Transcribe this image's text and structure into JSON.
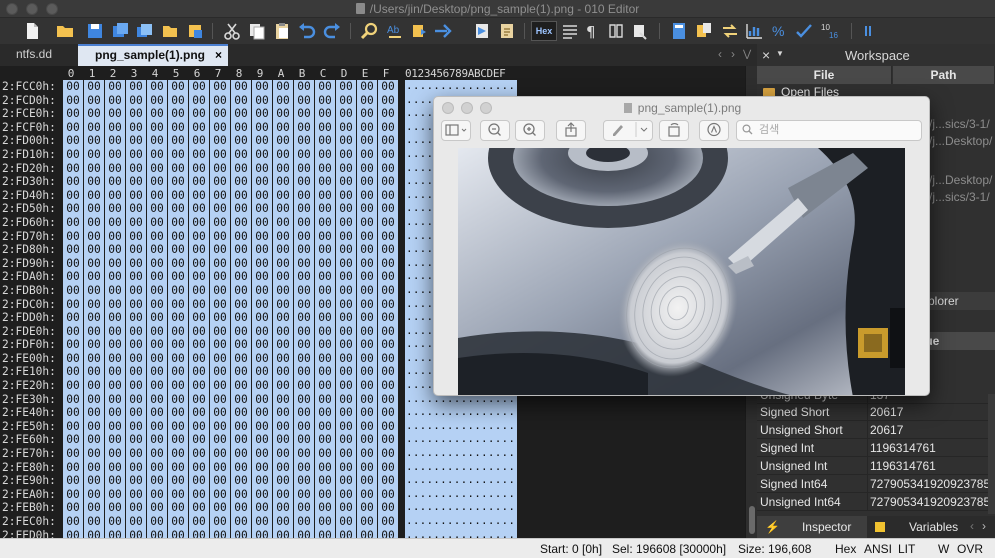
{
  "window": {
    "title": "/Users/jin/Desktop/png_sample(1).png - 010 Editor"
  },
  "toolbar": {
    "hex_label": "Hex"
  },
  "tabs": [
    {
      "label": "ntfs.dd"
    },
    {
      "label": "png_sample(1).png"
    }
  ],
  "tab_nav": {
    "left": "‹",
    "right": "›",
    "menu": "⋁",
    "close": "×"
  },
  "hex": {
    "column_headers": [
      "0",
      "1",
      "2",
      "3",
      "4",
      "5",
      "6",
      "7",
      "8",
      "9",
      "A",
      "B",
      "C",
      "D",
      "E",
      "F"
    ],
    "ascii_header": "0123456789ABCDEF",
    "byte_value": "00",
    "ascii_row": "................",
    "rows": [
      "2:FCC0h:",
      "2:FCD0h:",
      "2:FCE0h:",
      "2:FCF0h:",
      "2:FD00h:",
      "2:FD10h:",
      "2:FD20h:",
      "2:FD30h:",
      "2:FD40h:",
      "2:FD50h:",
      "2:FD60h:",
      "2:FD70h:",
      "2:FD80h:",
      "2:FD90h:",
      "2:FDA0h:",
      "2:FDB0h:",
      "2:FDC0h:",
      "2:FDD0h:",
      "2:FDE0h:",
      "2:FDF0h:",
      "2:FE00h:",
      "2:FE10h:",
      "2:FE20h:",
      "2:FE30h:",
      "2:FE40h:",
      "2:FE50h:",
      "2:FE60h:",
      "2:FE70h:",
      "2:FE80h:",
      "2:FE90h:",
      "2:FEA0h:",
      "2:FEB0h:",
      "2:FEC0h:",
      "2:FED0h:"
    ]
  },
  "workspace": {
    "title": "Workspace",
    "close": "×",
    "col_file": "File",
    "col_path": "Path",
    "open_files": "Open Files",
    "paths": [
      "/j...sics/3-1/",
      "/j...Desktop/",
      "/j...Desktop/",
      "/j...sics/3-1/"
    ],
    "explorer_label": "xplorer",
    "value_header": "lue"
  },
  "inspector": {
    "partial_row": "Unsigned Byte",
    "partial_value": "137",
    "rows": [
      {
        "name": "Signed Short",
        "value": "20617"
      },
      {
        "name": "Unsigned Short",
        "value": "20617"
      },
      {
        "name": "Signed Int",
        "value": "1196314761"
      },
      {
        "name": "Unsigned Int",
        "value": "1196314761"
      },
      {
        "name": "Signed Int64",
        "value": "727905341920923785"
      },
      {
        "name": "Unsigned Int64",
        "value": "727905341920923785"
      }
    ],
    "tab_inspector": "Inspector",
    "tab_variables": "Variables"
  },
  "status": {
    "start": "Start: 0 [0h]",
    "sel": "Sel: 196608 [30000h]",
    "size": "Size: 196,608",
    "hex": "Hex",
    "ansi": "ANSI",
    "lit": "LIT",
    "w": "W",
    "ovr": "OVR"
  },
  "preview": {
    "title": "png_sample(1).png",
    "search_placeholder": "검색"
  }
}
